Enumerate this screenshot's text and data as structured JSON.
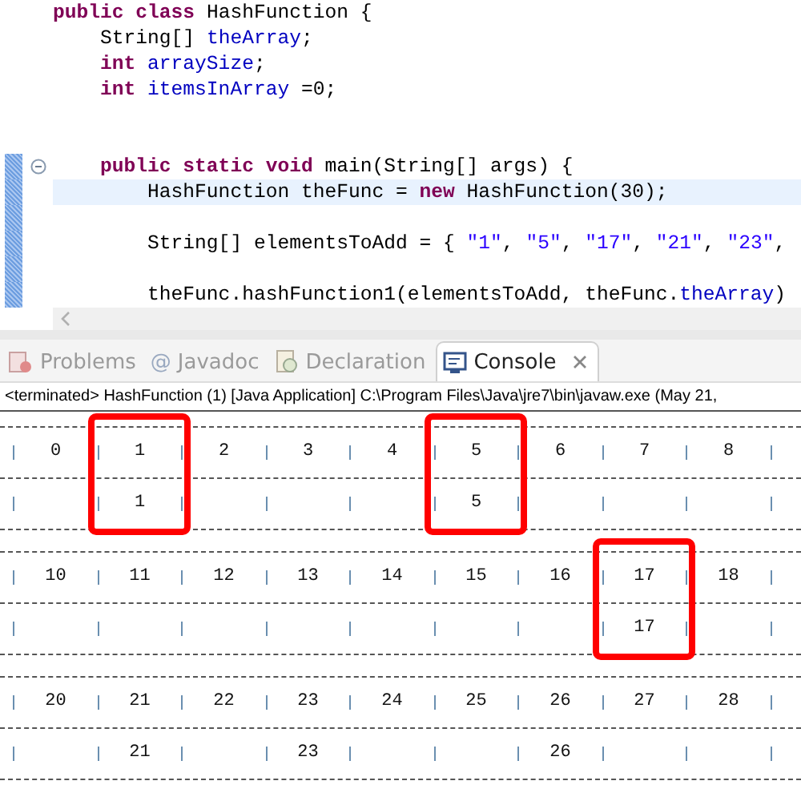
{
  "editor": {
    "lines": [
      {
        "kind": "code",
        "changed": false,
        "current": false,
        "fold": false,
        "segments": [
          {
            "kind": "keyword",
            "text": "public class"
          },
          {
            "kind": "plain",
            "text": " HashFunction {"
          }
        ]
      },
      {
        "kind": "code",
        "changed": false,
        "current": false,
        "fold": false,
        "segments": [
          {
            "kind": "plain",
            "text": "    String[] "
          },
          {
            "kind": "field",
            "text": "theArray"
          },
          {
            "kind": "plain",
            "text": ";"
          }
        ]
      },
      {
        "kind": "code",
        "changed": false,
        "current": false,
        "fold": false,
        "segments": [
          {
            "kind": "keyword",
            "text": "    int"
          },
          {
            "kind": "field",
            "text": " arraySize"
          },
          {
            "kind": "plain",
            "text": ";"
          }
        ]
      },
      {
        "kind": "code",
        "changed": false,
        "current": false,
        "fold": false,
        "segments": [
          {
            "kind": "keyword",
            "text": "    int"
          },
          {
            "kind": "field",
            "text": " itemsInArray"
          },
          {
            "kind": "plain",
            "text": " =0;"
          }
        ]
      },
      {
        "kind": "blank",
        "changed": false,
        "current": false,
        "fold": false
      },
      {
        "kind": "blank",
        "changed": false,
        "current": false,
        "fold": false
      },
      {
        "kind": "code",
        "changed": true,
        "current": false,
        "fold": true,
        "segments": [
          {
            "kind": "keyword",
            "text": "    public static void"
          },
          {
            "kind": "plain",
            "text": " main(String[] args) {"
          }
        ]
      },
      {
        "kind": "code",
        "changed": true,
        "current": true,
        "fold": false,
        "segments": [
          {
            "kind": "plain",
            "text": "        HashFunction theFunc = "
          },
          {
            "kind": "keyword",
            "text": "new"
          },
          {
            "kind": "plain",
            "text": " HashFunction(30);"
          }
        ]
      },
      {
        "kind": "blank",
        "changed": true,
        "current": false,
        "fold": false
      },
      {
        "kind": "code",
        "changed": true,
        "current": false,
        "fold": false,
        "segments": [
          {
            "kind": "plain",
            "text": "        String[] elementsToAdd = { "
          },
          {
            "kind": "string",
            "text": "\"1\""
          },
          {
            "kind": "plain",
            "text": ", "
          },
          {
            "kind": "string",
            "text": "\"5\""
          },
          {
            "kind": "plain",
            "text": ", "
          },
          {
            "kind": "string",
            "text": "\"17\""
          },
          {
            "kind": "plain",
            "text": ", "
          },
          {
            "kind": "string",
            "text": "\"21\""
          },
          {
            "kind": "plain",
            "text": ", "
          },
          {
            "kind": "string",
            "text": "\"23\""
          },
          {
            "kind": "plain",
            "text": ","
          }
        ]
      },
      {
        "kind": "blank",
        "changed": true,
        "current": false,
        "fold": false
      },
      {
        "kind": "code",
        "changed": true,
        "current": false,
        "fold": false,
        "segments": [
          {
            "kind": "plain",
            "text": "        theFunc.hashFunction1(elementsToAdd, theFunc."
          },
          {
            "kind": "field",
            "text": "theArray"
          },
          {
            "kind": "plain",
            "text": ")"
          }
        ]
      }
    ]
  },
  "tabs": [
    {
      "label": "Problems",
      "selected": false,
      "closable": false
    },
    {
      "label": "Javadoc",
      "glyph": "@",
      "selected": false,
      "closable": false
    },
    {
      "label": "Declaration",
      "selected": false,
      "closable": false
    },
    {
      "label": "Console",
      "selected": true,
      "closable": true
    }
  ],
  "console": {
    "status_line": "<terminated> HashFunction (1) [Java Application] C:\\Program Files\\Java\\jre7\\bin\\javaw.exe (May 21,",
    "blocks": [
      {
        "cells": [
          {
            "index": "0",
            "highlighted": false
          },
          {
            "index": "1",
            "value": "1",
            "highlighted": true
          },
          {
            "index": "2",
            "highlighted": false
          },
          {
            "index": "3",
            "highlighted": false
          },
          {
            "index": "4",
            "highlighted": false
          },
          {
            "index": "5",
            "value": "5",
            "highlighted": true
          },
          {
            "index": "6",
            "highlighted": false
          },
          {
            "index": "7",
            "highlighted": false
          },
          {
            "index": "8",
            "highlighted": false
          }
        ]
      },
      {
        "cells": [
          {
            "index": "10",
            "highlighted": false
          },
          {
            "index": "11",
            "highlighted": false
          },
          {
            "index": "12",
            "highlighted": false
          },
          {
            "index": "13",
            "highlighted": false
          },
          {
            "index": "14",
            "highlighted": false
          },
          {
            "index": "15",
            "highlighted": false
          },
          {
            "index": "16",
            "highlighted": false
          },
          {
            "index": "17",
            "value": "17",
            "highlighted": true
          },
          {
            "index": "18",
            "highlighted": false
          }
        ]
      },
      {
        "cells": [
          {
            "index": "20",
            "highlighted": false
          },
          {
            "index": "21",
            "value": "21",
            "highlighted": false
          },
          {
            "index": "22",
            "highlighted": false
          },
          {
            "index": "23",
            "value": "23",
            "highlighted": false
          },
          {
            "index": "24",
            "highlighted": false
          },
          {
            "index": "25",
            "highlighted": false
          },
          {
            "index": "26",
            "value": "26",
            "highlighted": false
          },
          {
            "index": "27",
            "highlighted": false
          },
          {
            "index": "28",
            "highlighted": false
          }
        ]
      }
    ]
  }
}
